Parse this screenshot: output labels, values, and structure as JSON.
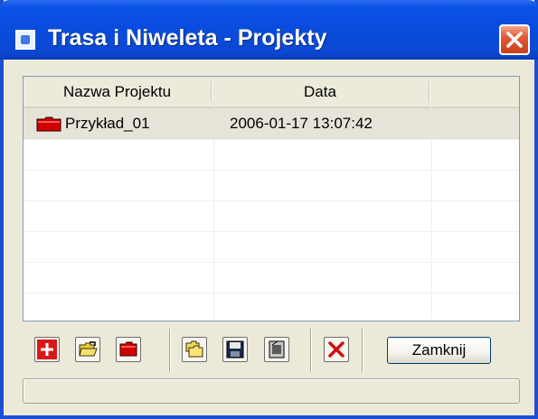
{
  "window": {
    "title": "Trasa i Niweleta - Projekty",
    "accent_color": "#1b4fd6",
    "close_icon": "close-icon"
  },
  "list": {
    "columns": [
      "Nazwa Projektu",
      "Data"
    ],
    "rows": [
      {
        "name": "Przykład_01",
        "date": "2006-01-17   13:07:42",
        "icon": "red-folder-icon",
        "selected": true
      }
    ]
  },
  "toolbar": {
    "buttons": [
      {
        "name": "new-project-button",
        "icon": "plus-icon"
      },
      {
        "name": "open-project-button",
        "icon": "open-folder-icon"
      },
      {
        "name": "project-folder-button",
        "icon": "red-folder-icon"
      },
      {
        "name": "copy-project-button",
        "icon": "folders-icon"
      },
      {
        "name": "save-project-button",
        "icon": "floppy-disk-icon"
      },
      {
        "name": "export-project-button",
        "icon": "document-icon"
      },
      {
        "name": "delete-project-button",
        "icon": "delete-x-icon"
      }
    ],
    "close_label": "Zamknij"
  }
}
